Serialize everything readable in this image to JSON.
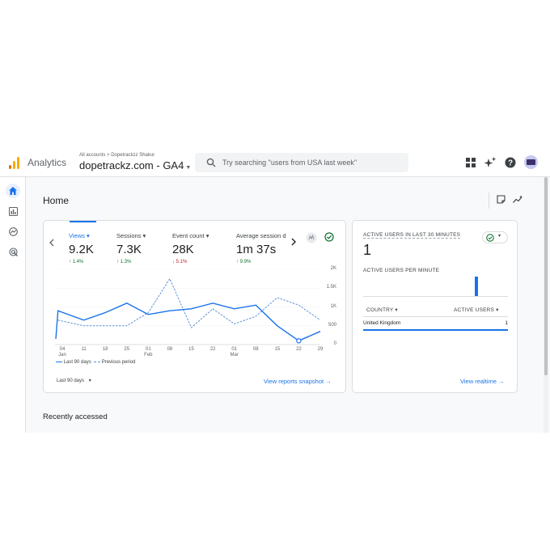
{
  "topbar": {
    "app_name": "Analytics",
    "breadcrumb": "All accounts > Dopetrackzz Shakur",
    "property": "dopetrackz.com - GA4",
    "search_placeholder": "Try searching \"users from USA last week\""
  },
  "icons": {
    "apps": "apps-grid-icon",
    "insights": "sparkle-icon",
    "help": "help-icon",
    "nav_home": "home-icon",
    "nav_reports": "bar-chart-icon",
    "nav_explore": "explore-icon",
    "nav_advertising": "advertising-icon"
  },
  "colors": {
    "accent": "#1a73e8",
    "up": "#137333",
    "down": "#c5221f",
    "logo": [
      "#f9ab00",
      "#e37400"
    ]
  },
  "page": {
    "title": "Home",
    "recently_accessed": "Recently accessed"
  },
  "overview": {
    "tabs": [
      {
        "label": "Views",
        "value": "9.2K",
        "change": "1.4%",
        "direction": "up",
        "active": true
      },
      {
        "label": "Sessions",
        "value": "7.3K",
        "change": "1.3%",
        "direction": "up",
        "active": false
      },
      {
        "label": "Event count",
        "value": "28K",
        "change": "5.1%",
        "direction": "down",
        "active": false
      },
      {
        "label": "Average session d",
        "value": "1m 37s",
        "change": "9.9%",
        "direction": "up",
        "active": false
      }
    ],
    "date_range": "Last 90 days",
    "view_link": "View reports snapshot"
  },
  "chart_data": {
    "type": "line",
    "x": [
      "04 Jan",
      "11",
      "18",
      "25",
      "01 Feb",
      "08",
      "15",
      "22",
      "01 Mar",
      "08",
      "15",
      "22",
      "29"
    ],
    "x_tick_labels": [
      [
        "04",
        "Jan"
      ],
      [
        "11",
        ""
      ],
      [
        "18",
        ""
      ],
      [
        "25",
        ""
      ],
      [
        "01",
        "Feb"
      ],
      [
        "08",
        ""
      ],
      [
        "15",
        ""
      ],
      [
        "22",
        ""
      ],
      [
        "01",
        "Mar"
      ],
      [
        "08",
        ""
      ],
      [
        "15",
        ""
      ],
      [
        "22",
        ""
      ],
      [
        "29",
        ""
      ]
    ],
    "y_ticks": [
      "2K",
      "1.5K",
      "1K",
      "500",
      "0"
    ],
    "ylim": [
      0,
      2000
    ],
    "series": [
      {
        "name": "Last 90 days",
        "style": "solid",
        "color": "#1a73e8",
        "points": [
          [
            -0.3,
            150
          ],
          [
            -0.2,
            900
          ],
          [
            1,
            650
          ],
          [
            2,
            850
          ],
          [
            3,
            1100
          ],
          [
            4,
            800
          ],
          [
            5,
            900
          ],
          [
            6,
            950
          ],
          [
            7,
            1100
          ],
          [
            8,
            950
          ],
          [
            9,
            1050
          ],
          [
            10,
            500
          ],
          [
            11,
            100
          ],
          [
            12,
            350
          ]
        ]
      },
      {
        "name": "Previous period",
        "style": "dashed",
        "color": "#5b93d8",
        "points": [
          [
            -0.2,
            650
          ],
          [
            1,
            500
          ],
          [
            2,
            500
          ],
          [
            3,
            500
          ],
          [
            4,
            850
          ],
          [
            5,
            1750
          ],
          [
            6,
            450
          ],
          [
            7,
            950
          ],
          [
            8,
            550
          ],
          [
            9,
            750
          ],
          [
            10,
            1250
          ],
          [
            11,
            1050
          ],
          [
            12,
            650
          ]
        ]
      }
    ]
  },
  "realtime": {
    "title": "ACTIVE USERS IN LAST 30 MINUTES",
    "value": "1",
    "per_minute_label": "ACTIVE USERS PER MINUTE",
    "bars": [
      0,
      0,
      0,
      0,
      0,
      0,
      0,
      0,
      0,
      0,
      0,
      0,
      0,
      0,
      0,
      0,
      0,
      0,
      0,
      0,
      0,
      0,
      0,
      1,
      0,
      0,
      0,
      0,
      0,
      0
    ],
    "country_header": "COUNTRY",
    "users_header": "ACTIVE USERS",
    "rows": [
      {
        "country": "United Kingdom",
        "users": "1",
        "share": 1.0
      }
    ],
    "view_link": "View realtime"
  }
}
